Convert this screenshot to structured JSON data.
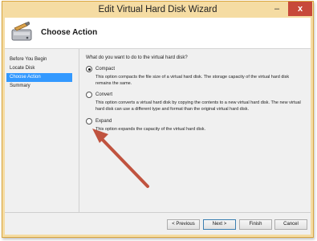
{
  "window": {
    "title": "Edit Virtual Hard Disk Wizard",
    "close_glyph": "x",
    "minimize_glyph": "–"
  },
  "header": {
    "page_title": "Choose Action",
    "icon": "disk-wizard-icon"
  },
  "steps": [
    {
      "label": "Before You Begin",
      "active": false
    },
    {
      "label": "Locate Disk",
      "active": false
    },
    {
      "label": "Choose Action",
      "active": true
    },
    {
      "label": "Summary",
      "active": false
    }
  ],
  "main": {
    "question": "What do you want to do to the virtual hard disk?",
    "options": [
      {
        "label": "Compact",
        "checked": true,
        "description": "This option compacts the file size of a virtual hard disk. The storage capacity of the virtual hard disk remains the same."
      },
      {
        "label": "Convert",
        "checked": false,
        "description": "This option converts a virtual hard disk by copying the contents to a new virtual hard disk. The new virtual hard disk can use a different type and format than the original virtual hard disk."
      },
      {
        "label": "Expand",
        "checked": false,
        "description": "This option expands the capacity of the virtual hard disk."
      }
    ]
  },
  "footer": {
    "previous_label": "< Previous",
    "next_label": "Next >",
    "finish_label": "Finish",
    "cancel_label": "Cancel"
  },
  "colors": {
    "window_frame": "#f5dca3",
    "selection": "#3399ff",
    "close_button": "#c7493a",
    "annotation_arrow": "#c0533f"
  }
}
